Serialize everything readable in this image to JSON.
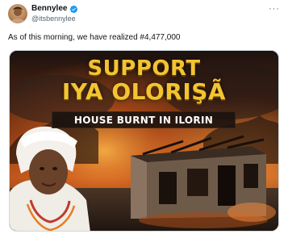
{
  "author": {
    "display_name": "Bennylee",
    "handle": "@itsbennylee",
    "verified": true,
    "avatar": "user-avatar"
  },
  "tweet": {
    "text": "As of this morning, we have realized #4,477,000"
  },
  "media": {
    "headline_line1": "SUPPORT",
    "headline_line2": "IYA OLORIŞÃ",
    "subtitle": "HOUSE BURNT IN ILORIN"
  },
  "icons": {
    "verified": "verified-badge-icon",
    "more": "more-options-icon"
  },
  "colors": {
    "verified": "#1d9bf0",
    "headline": "#f3c431",
    "name": "#0f1419",
    "handle": "#536471"
  }
}
